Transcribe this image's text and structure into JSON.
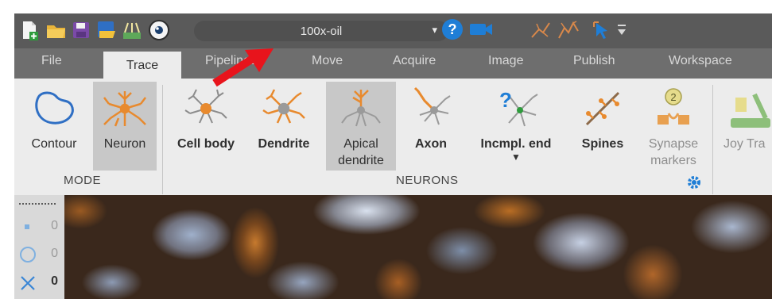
{
  "toolbar": {
    "objective": "100x-oil",
    "icons": [
      "new-file-icon",
      "open-folder-icon",
      "save-icon",
      "save-as-icon",
      "ruler-icon",
      "eye-icon",
      "help-icon",
      "camera-icon",
      "trace-tool-icon",
      "trace-tool-2-icon",
      "select-arrow-icon",
      "overflow-icon"
    ]
  },
  "tabs": [
    {
      "label": "File"
    },
    {
      "label": "Trace"
    },
    {
      "label": "Pipelines"
    },
    {
      "label": "Move"
    },
    {
      "label": "Acquire"
    },
    {
      "label": "Image"
    },
    {
      "label": "Publish"
    },
    {
      "label": "Workspace"
    }
  ],
  "active_tab": "Trace",
  "ribbon": {
    "mode": {
      "group_label": "MODE",
      "buttons": [
        {
          "label": "Contour",
          "selected": false
        },
        {
          "label": "Neuron",
          "selected": true
        }
      ]
    },
    "neurons": {
      "group_label": "NEURONS",
      "buttons": [
        {
          "label": "Cell body",
          "bold": true
        },
        {
          "label": "Dendrite",
          "bold": true
        },
        {
          "label": "Apical dendrite",
          "line1": "Apical",
          "line2": "dendrite",
          "selected": true
        },
        {
          "label": "Axon",
          "bold": true
        },
        {
          "label": "Incmpl. end",
          "bold": true,
          "dropdown": true
        },
        {
          "label": "Spines",
          "bold": true
        },
        {
          "label": "Synapse markers",
          "line1": "Synapse",
          "line2": "markers",
          "disabled": true,
          "badge": "2"
        }
      ]
    },
    "next": {
      "label": "Joy Tra"
    }
  },
  "left_panel": {
    "rows": [
      {
        "icon": "dot-marker-icon",
        "value": "0"
      },
      {
        "icon": "circle-marker-icon",
        "value": "0"
      },
      {
        "icon": "x-marker-icon",
        "value": "0"
      }
    ]
  },
  "colors": {
    "accent": "#e88a2e",
    "selection": "#c8c8c8",
    "titlebar": "#5a5a5a",
    "tabbar": "#6e6e6e",
    "annotation": "#e8141c"
  }
}
